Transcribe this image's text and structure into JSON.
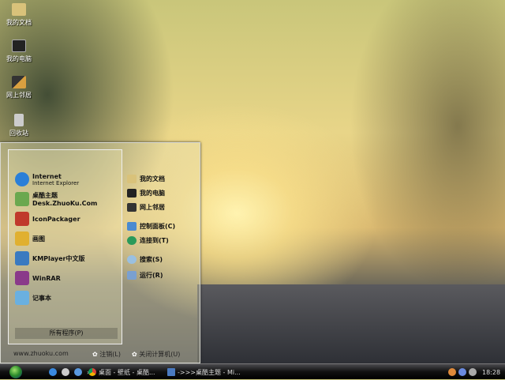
{
  "desktop": {
    "icons": [
      {
        "label": "我的文档",
        "icon": "folder-icon"
      },
      {
        "label": "我的电脑",
        "icon": "computer-icon"
      },
      {
        "label": "网上邻居",
        "icon": "network-icon"
      },
      {
        "label": "回收站",
        "icon": "recycle-bin-icon"
      }
    ]
  },
  "start_menu": {
    "programs": [
      {
        "label": "Internet",
        "sub": "Internet Explorer",
        "icon": "ie-icon",
        "color": "#2a7fd8"
      },
      {
        "label": "桌酷主题Desk.ZhuoKu.Com",
        "icon": "zhuoku-icon",
        "color": "#6aa84f"
      },
      {
        "label": "IconPackager",
        "icon": "iconpackager-icon",
        "color": "#c0392b"
      },
      {
        "label": "画图",
        "icon": "paint-icon",
        "color": "#e0b030"
      },
      {
        "label": "KMPlayer中文版",
        "icon": "kmplayer-icon",
        "color": "#3a7ac0"
      },
      {
        "label": "WinRAR",
        "icon": "winrar-icon",
        "color": "#8a3a8a"
      },
      {
        "label": "记事本",
        "icon": "notepad-icon",
        "color": "#6ab0e0"
      }
    ],
    "all_programs": "所有程序(P)",
    "places": [
      {
        "label": "我的文档",
        "icon": "folder-icon"
      },
      {
        "label": "我的电脑",
        "icon": "computer-icon"
      },
      {
        "label": "网上邻居",
        "icon": "network-icon"
      },
      {
        "label": "控制面板(C)",
        "icon": "control-panel-icon"
      },
      {
        "label": "连接到(T)",
        "icon": "connect-icon"
      },
      {
        "label": "搜索(S)",
        "icon": "search-icon"
      },
      {
        "label": "运行(R)",
        "icon": "run-icon"
      }
    ],
    "footer": {
      "site": "www.zhuoku.com",
      "logoff": "注销(L)",
      "shutdown": "关闭计算机(U)"
    }
  },
  "taskbar": {
    "tasks": [
      {
        "label": "桌面 - 壁纸 - 桌酷...",
        "icon": "chrome-icon"
      },
      {
        "label": "->>>桌酷主题 - Mi...",
        "icon": "document-icon"
      }
    ],
    "clock": "18:28",
    "chevron": "»"
  }
}
